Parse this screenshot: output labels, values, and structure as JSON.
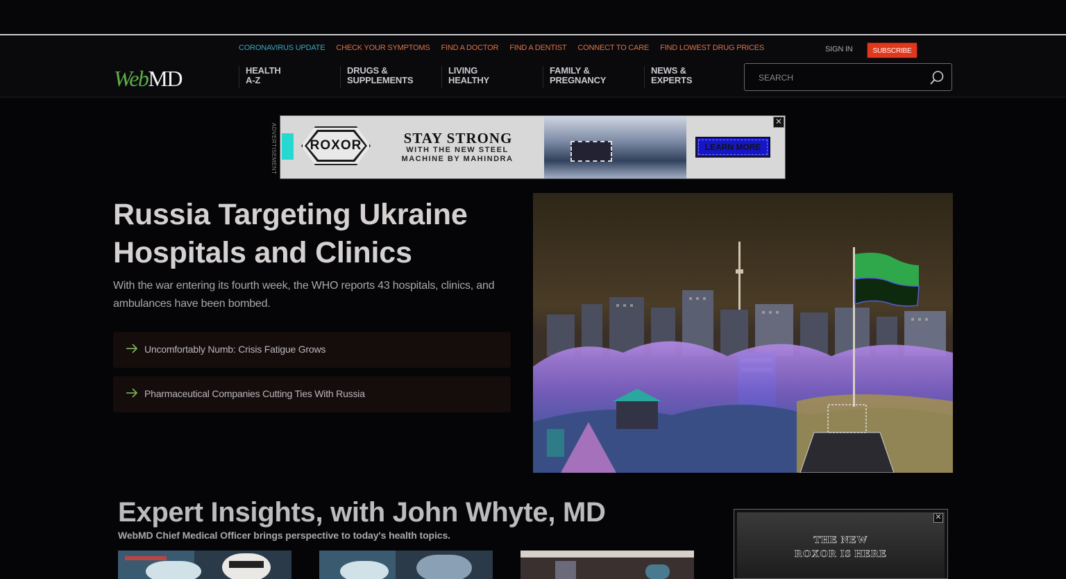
{
  "utility_nav": [
    "CORONAVIRUS UPDATE",
    "CHECK YOUR SYMPTOMS",
    "FIND A DOCTOR",
    "FIND A DENTIST",
    "CONNECT TO CARE",
    "FIND LOWEST DRUG PRICES"
  ],
  "account": {
    "signin": "SIGN IN",
    "subscribe": "SUBSCRIBE"
  },
  "logo": {
    "part1": "Web",
    "part2": "MD"
  },
  "main_nav": [
    {
      "line1": "HEALTH",
      "line2": "A-Z"
    },
    {
      "line1": "DRUGS &",
      "line2": "SUPPLEMENTS"
    },
    {
      "line1": "LIVING",
      "line2": "HEALTHY"
    },
    {
      "line1": "FAMILY &",
      "line2": "PREGNANCY"
    },
    {
      "line1": "NEWS &",
      "line2": "EXPERTS"
    }
  ],
  "search": {
    "placeholder": "SEARCH"
  },
  "ad_banner": {
    "label": "ADVERTISEMENT",
    "brand": "ROXOR",
    "headline": "STAY STRONG",
    "subline1": "WITH THE NEW STEEL",
    "subline2": "MACHINE BY MAHINDRA",
    "cta": "LEARN MORE",
    "close": "✕"
  },
  "hero": {
    "title": "Russia Targeting Ukraine Hospitals and Clinics",
    "summary": "With the war entering its fourth week, the WHO reports 43 hospitals, clinics, and ambulances have been bombed.",
    "related": [
      "Uncomfortably Numb: Crisis Fatigue Grows",
      "Pharmaceutical Companies Cutting Ties With Russia"
    ]
  },
  "expert": {
    "title": "Expert Insights, with John Whyte, MD",
    "subtitle": "WebMD Chief Medical Officer brings perspective to today's health topics."
  },
  "side_ad": {
    "line1": "THE NEW",
    "line2": "ROXOR IS HERE",
    "close": "✕"
  },
  "colors": {
    "accent_orange": "#e0724a",
    "subscribe_red": "#e0381c",
    "logo_green": "#5dae48",
    "arrow_green": "#7fb85a"
  }
}
